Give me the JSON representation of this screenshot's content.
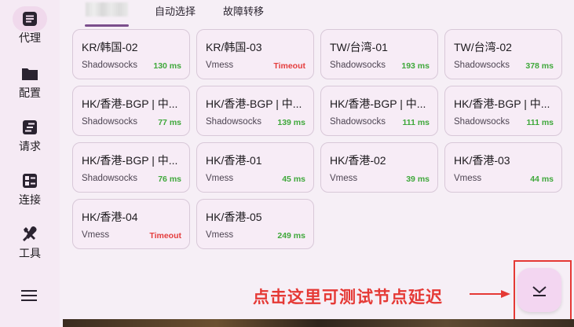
{
  "sidebar": {
    "items": [
      {
        "label": "代理",
        "icon": "list-icon"
      },
      {
        "label": "配置",
        "icon": "folder-icon"
      },
      {
        "label": "请求",
        "icon": "requests-icon"
      },
      {
        "label": "连接",
        "icon": "connections-icon"
      },
      {
        "label": "工具",
        "icon": "tools-icon"
      }
    ],
    "menu_icon": "hamburger-icon"
  },
  "tabs": [
    {
      "label": ""
    },
    {
      "label": "自动选择"
    },
    {
      "label": "故障转移"
    }
  ],
  "proxies": [
    {
      "name": "KR/韩国-02",
      "type": "Shadowsocks",
      "delay": "130 ms",
      "status": "ok"
    },
    {
      "name": "KR/韩国-03",
      "type": "Vmess",
      "delay": "Timeout",
      "status": "timeout"
    },
    {
      "name": "TW/台湾-01",
      "type": "Shadowsocks",
      "delay": "193 ms",
      "status": "ok"
    },
    {
      "name": "TW/台湾-02",
      "type": "Shadowsocks",
      "delay": "378 ms",
      "status": "ok"
    },
    {
      "name": "HK/香港-BGP | 中...",
      "type": "Shadowsocks",
      "delay": "77 ms",
      "status": "ok"
    },
    {
      "name": "HK/香港-BGP | 中...",
      "type": "Shadowsocks",
      "delay": "139 ms",
      "status": "ok"
    },
    {
      "name": "HK/香港-BGP | 中...",
      "type": "Shadowsocks",
      "delay": "111 ms",
      "status": "ok"
    },
    {
      "name": "HK/香港-BGP | 中...",
      "type": "Shadowsocks",
      "delay": "111 ms",
      "status": "ok"
    },
    {
      "name": "HK/香港-BGP | 中...",
      "type": "Shadowsocks",
      "delay": "76 ms",
      "status": "ok"
    },
    {
      "name": "HK/香港-01",
      "type": "Vmess",
      "delay": "45 ms",
      "status": "ok"
    },
    {
      "name": "HK/香港-02",
      "type": "Vmess",
      "delay": "39 ms",
      "status": "ok"
    },
    {
      "name": "HK/香港-03",
      "type": "Vmess",
      "delay": "44 ms",
      "status": "ok"
    },
    {
      "name": "HK/香港-04",
      "type": "Vmess",
      "delay": "Timeout",
      "status": "timeout"
    },
    {
      "name": "HK/香港-05",
      "type": "Vmess",
      "delay": "249 ms",
      "status": "ok"
    }
  ],
  "annotation": {
    "text": "点击这里可测试节点延迟"
  },
  "fab": {
    "icon": "latency-test-icon"
  },
  "colors": {
    "accent": "#7b4e8c",
    "ok": "#3fa83b",
    "timeout": "#e43d3d",
    "annotation": "#e53935"
  }
}
